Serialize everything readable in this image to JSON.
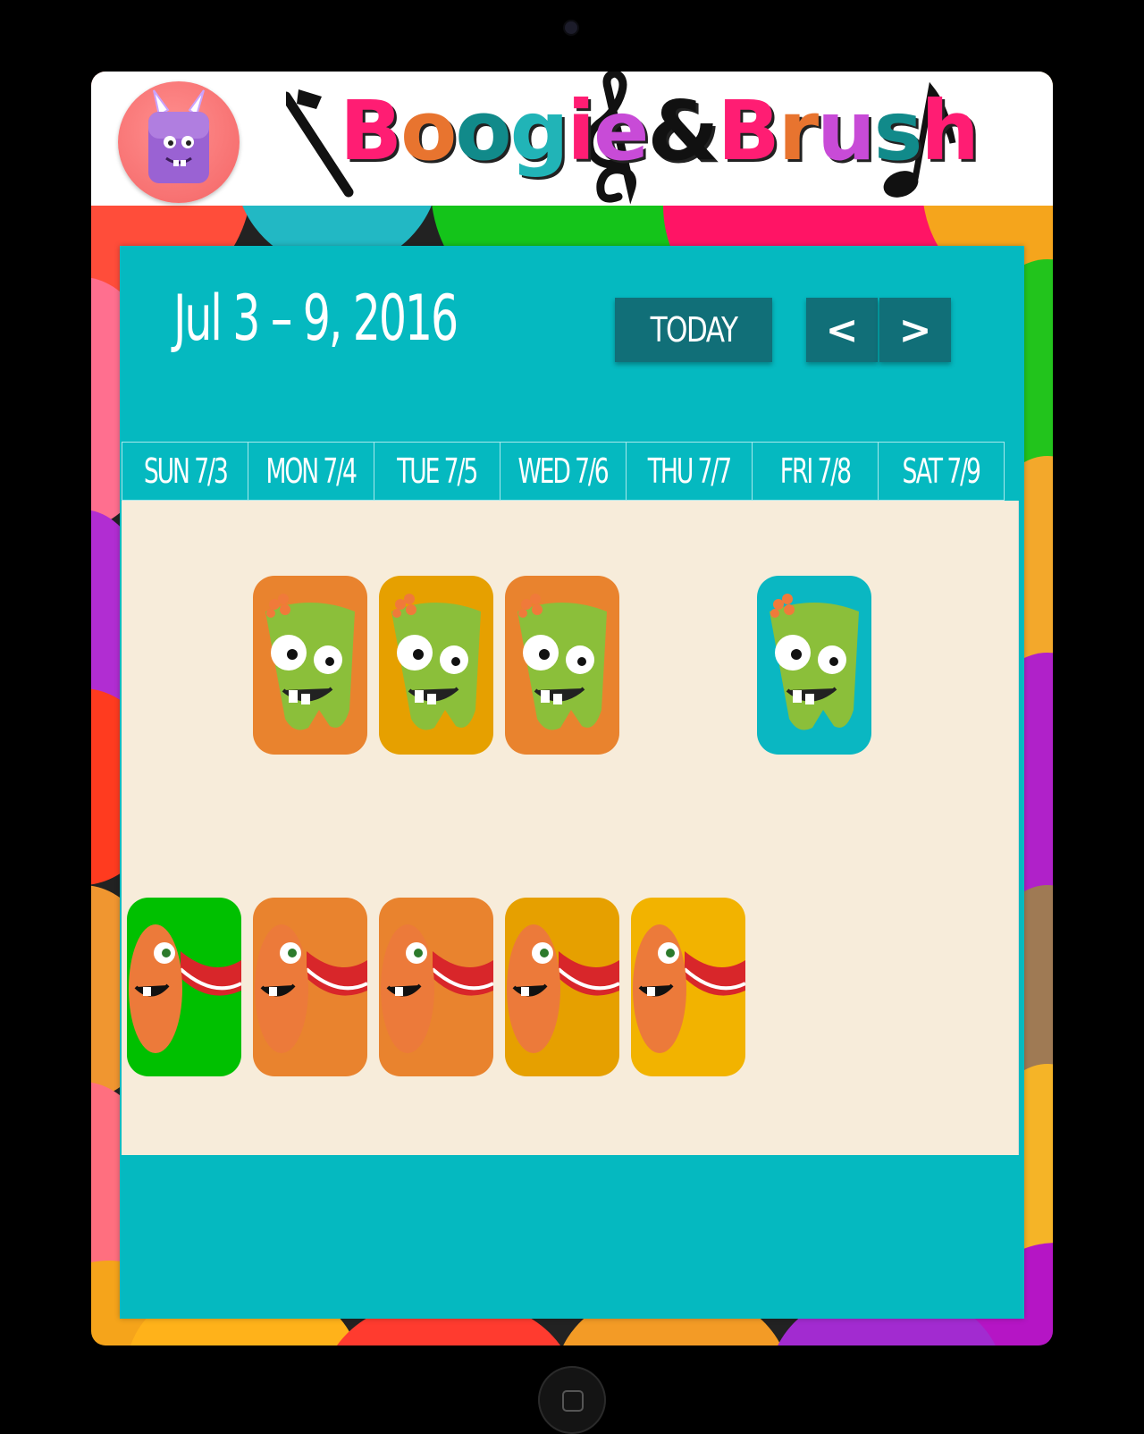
{
  "app": {
    "title": "Boogie&Brush",
    "title_parts": [
      {
        "text": "B",
        "color": "#ff1d73"
      },
      {
        "text": "o",
        "color": "#e8742f"
      },
      {
        "text": "o",
        "color": "#118a8a"
      },
      {
        "text": "g",
        "color": "#21b4b7"
      },
      {
        "text": "i",
        "color": "#ff1d73"
      },
      {
        "text": "e",
        "color": "#c84bd7"
      },
      {
        "text": "&",
        "color": "#111111"
      },
      {
        "text": "B",
        "color": "#ff1d73"
      },
      {
        "text": "r",
        "color": "#e8742f"
      },
      {
        "text": "u",
        "color": "#c84bd7"
      },
      {
        "text": "s",
        "color": "#118a8a"
      },
      {
        "text": "h",
        "color": "#ff1d73"
      }
    ],
    "avatar_icon": "purple-monster-avatar-icon"
  },
  "calendar": {
    "range_label": "Jul 3 – 9, 2016",
    "today_label": "TODAY",
    "prev_label": "<",
    "next_label": ">",
    "days": [
      {
        "label": "SUN 7/3",
        "morning": null,
        "evening": "green"
      },
      {
        "label": "MON 7/4",
        "morning": "orange",
        "evening": "orange"
      },
      {
        "label": "TUE 7/5",
        "morning": "amber",
        "evening": "orange"
      },
      {
        "label": "WED 7/6",
        "morning": "orange",
        "evening": "amber"
      },
      {
        "label": "THU 7/7",
        "morning": null,
        "evening": "yellow"
      },
      {
        "label": "FRI 7/8",
        "morning": "teal",
        "evening": null
      },
      {
        "label": "SAT 7/9",
        "morning": null,
        "evening": null
      }
    ],
    "tile_colors": {
      "orange": "#e9832e",
      "amber": "#e6a000",
      "green": "#00c000",
      "teal": "#0ab7c2",
      "yellow": "#f2b300"
    }
  },
  "colors": {
    "panel": "#05b9c0",
    "button": "#116f78",
    "grid_bg": "#f7ecda"
  }
}
